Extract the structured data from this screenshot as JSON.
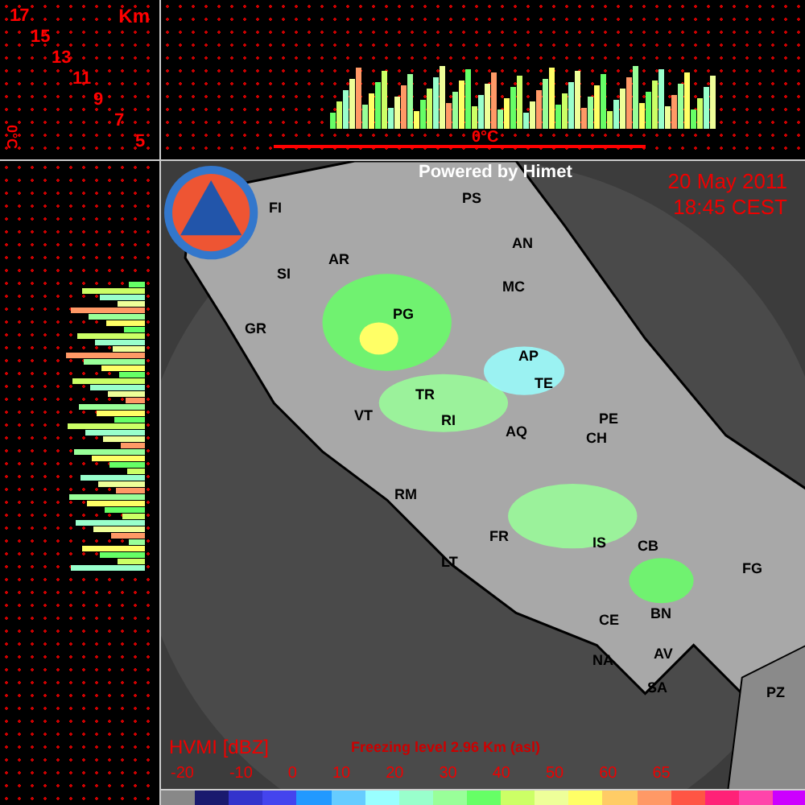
{
  "corner_scale": {
    "unit": "Km",
    "heights": [
      "17",
      "15",
      "13",
      "11",
      "9",
      "7",
      "5"
    ]
  },
  "top_profile": {
    "freezing_label": "0°C"
  },
  "side_profile": {
    "freezing_label": "0°C"
  },
  "map": {
    "credit": "Powered by Himet",
    "date": "20 May 2011",
    "time": "18:45 CEST",
    "cities": [
      {
        "code": "FI"
      },
      {
        "code": "PS"
      },
      {
        "code": "AN"
      },
      {
        "code": "SI"
      },
      {
        "code": "AR"
      },
      {
        "code": "MC"
      },
      {
        "code": "PG"
      },
      {
        "code": "GR"
      },
      {
        "code": "AP"
      },
      {
        "code": "TE"
      },
      {
        "code": "TR"
      },
      {
        "code": "VT"
      },
      {
        "code": "RI"
      },
      {
        "code": "AQ"
      },
      {
        "code": "PE"
      },
      {
        "code": "CH"
      },
      {
        "code": "RM"
      },
      {
        "code": "FR"
      },
      {
        "code": "IS"
      },
      {
        "code": "CB"
      },
      {
        "code": "LT"
      },
      {
        "code": "FG"
      },
      {
        "code": "CE"
      },
      {
        "code": "BN"
      },
      {
        "code": "NA"
      },
      {
        "code": "AV"
      },
      {
        "code": "SA"
      },
      {
        "code": "PZ"
      }
    ]
  },
  "legend": {
    "title": "HVMI [dBZ]",
    "freezing_level": "Freezing level  2.96 Km (asl)",
    "ticks": [
      "-20",
      "-10",
      "0",
      "10",
      "20",
      "30",
      "40",
      "50",
      "60",
      "65"
    ],
    "swatches": [
      {
        "color": "#888888"
      },
      {
        "color": "#1a1a6e"
      },
      {
        "color": "#3333cc"
      },
      {
        "color": "#4444ee"
      },
      {
        "color": "#2299ff"
      },
      {
        "color": "#66ccff"
      },
      {
        "color": "#99ffff"
      },
      {
        "color": "#99ffcc"
      },
      {
        "color": "#99ff99"
      },
      {
        "color": "#66ff66"
      },
      {
        "color": "#ccff66"
      },
      {
        "color": "#eeff99"
      },
      {
        "color": "#ffff66"
      },
      {
        "color": "#ffcc66"
      },
      {
        "color": "#ff9966"
      },
      {
        "color": "#ff5544"
      },
      {
        "color": "#ff2277"
      },
      {
        "color": "#ff44aa"
      },
      {
        "color": "#cc00ff"
      }
    ]
  }
}
